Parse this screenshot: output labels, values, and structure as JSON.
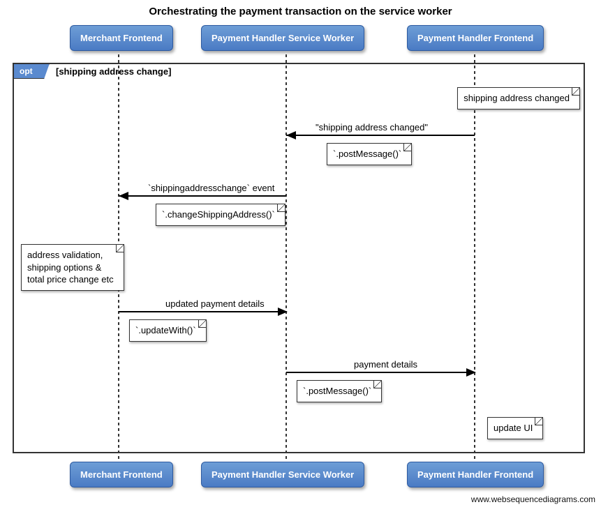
{
  "title": "Orchestrating the payment transaction on the service worker",
  "participants": {
    "merchant": "Merchant Frontend",
    "sw": "Payment Handler Service Worker",
    "frontend": "Payment Handler Frontend"
  },
  "frame": {
    "tag": "opt",
    "guard": "[shipping address change]"
  },
  "notes": {
    "addr_changed": "shipping address changed",
    "validation": "address validation,\nshipping options &\ntotal price change etc",
    "update_ui": "update UI"
  },
  "messages": {
    "m1_label": "\"shipping address changed\"",
    "m1_note": "`.postMessage()`",
    "m2_label": "`shippingaddresschange` event",
    "m2_note": "`.changeShippingAddress()`",
    "m3_label": "updated payment details",
    "m3_note": "`.updateWith()`",
    "m4_label": "payment details",
    "m4_note": "`.postMessage()`"
  },
  "watermark": "www.websequencediagrams.com",
  "x": {
    "merchant": 170,
    "sw": 410,
    "frontend": 680
  },
  "chart_data": {
    "type": "sequence-diagram",
    "participants": [
      "Merchant Frontend",
      "Payment Handler Service Worker",
      "Payment Handler Frontend"
    ],
    "fragments": [
      {
        "type": "opt",
        "guard": "shipping address change",
        "covers": [
          "Merchant Frontend",
          "Payment Handler Service Worker",
          "Payment Handler Frontend"
        ]
      }
    ],
    "events": [
      {
        "kind": "note",
        "over": "Payment Handler Frontend",
        "text": "shipping address changed"
      },
      {
        "kind": "message",
        "from": "Payment Handler Frontend",
        "to": "Payment Handler Service Worker",
        "label": "\"shipping address changed\"",
        "via": ".postMessage()"
      },
      {
        "kind": "message",
        "from": "Payment Handler Service Worker",
        "to": "Merchant Frontend",
        "label": "`shippingaddresschange` event",
        "via": ".changeShippingAddress()"
      },
      {
        "kind": "note",
        "over": "Merchant Frontend",
        "text": "address validation, shipping options & total price change etc"
      },
      {
        "kind": "message",
        "from": "Merchant Frontend",
        "to": "Payment Handler Service Worker",
        "label": "updated payment details",
        "via": ".updateWith()"
      },
      {
        "kind": "message",
        "from": "Payment Handler Service Worker",
        "to": "Payment Handler Frontend",
        "label": "payment details",
        "via": ".postMessage()"
      },
      {
        "kind": "note",
        "over": "Payment Handler Frontend",
        "text": "update UI"
      }
    ]
  }
}
